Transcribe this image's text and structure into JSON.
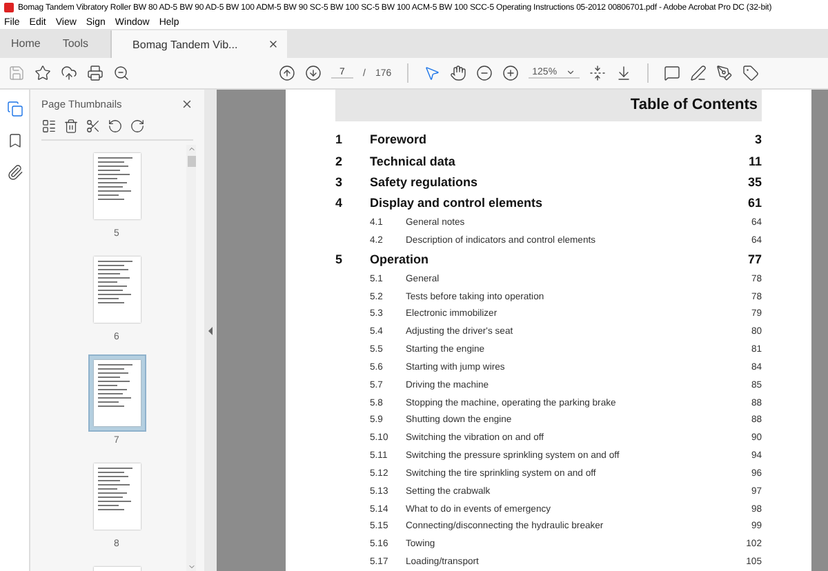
{
  "window": {
    "title": "Bomag Tandem Vibratory Roller BW 80 AD-5 BW 90 AD-5 BW 100 ADM-5 BW 90 SC-5 BW 100 SC-5 BW 100 ACM-5 BW 100 SCC-5 Operating Instructions 05-2012 00806701.pdf - Adobe Acrobat Pro DC (32-bit)"
  },
  "menu": [
    "File",
    "Edit",
    "View",
    "Sign",
    "Window",
    "Help"
  ],
  "tabs": [
    {
      "label": "Home",
      "selected": false,
      "kind": "nav"
    },
    {
      "label": "Tools",
      "selected": false,
      "kind": "nav"
    },
    {
      "label": "Bomag Tandem Vib...",
      "selected": true,
      "kind": "document"
    }
  ],
  "toolbar": {
    "page_current": "7",
    "page_separator": "/",
    "page_total": "176",
    "zoom": "125%"
  },
  "sidebar": {
    "title": "Page Thumbnails",
    "thumbnails": [
      {
        "label": "5",
        "selected": false
      },
      {
        "label": "6",
        "selected": false
      },
      {
        "label": "7",
        "selected": true
      },
      {
        "label": "8",
        "selected": false
      },
      {
        "selected": false
      }
    ]
  },
  "document": {
    "heading": "Table of Contents",
    "entries": [
      {
        "kind": "chapter",
        "number": "1",
        "title": "Foreword",
        "page": "3"
      },
      {
        "kind": "chapter",
        "number": "2",
        "title": "Technical data",
        "page": "11"
      },
      {
        "kind": "chapter",
        "number": "3",
        "title": "Safety regulations",
        "page": "35"
      },
      {
        "kind": "chapter",
        "number": "4",
        "title": "Display and control elements",
        "page": "61"
      },
      {
        "kind": "section",
        "number": "4.1",
        "title": "General notes",
        "page": "64"
      },
      {
        "kind": "section",
        "number": "4.2",
        "title": "Description of indicators and control elements",
        "page": "64"
      },
      {
        "kind": "chapter",
        "number": "5",
        "title": "Operation",
        "page": "77"
      },
      {
        "kind": "section",
        "number": "5.1",
        "title": "General",
        "page": "78"
      },
      {
        "kind": "section",
        "number": "5.2",
        "title": "Tests before taking into operation",
        "page": "78"
      },
      {
        "kind": "section",
        "number": "5.3",
        "title": "Electronic immobilizer",
        "page": "79"
      },
      {
        "kind": "section",
        "number": "5.4",
        "title": "Adjusting the driver's seat",
        "page": "80"
      },
      {
        "kind": "section",
        "number": "5.5",
        "title": "Starting the engine",
        "page": "81"
      },
      {
        "kind": "section",
        "number": "5.6",
        "title": "Starting with jump wires",
        "page": "84"
      },
      {
        "kind": "section",
        "number": "5.7",
        "title": "Driving the machine",
        "page": "85"
      },
      {
        "kind": "section",
        "number": "5.8",
        "title": "Stopping the machine, operating the parking brake",
        "page": "88"
      },
      {
        "kind": "section",
        "number": "5.9",
        "title": "Shutting down the engine",
        "page": "88"
      },
      {
        "kind": "section",
        "number": "5.10",
        "title": "Switching the vibration on and off",
        "page": "90"
      },
      {
        "kind": "section",
        "number": "5.11",
        "title": "Switching the pressure sprinkling system on and off",
        "page": "94"
      },
      {
        "kind": "section",
        "number": "5.12",
        "title": "Switching the tire sprinkling system on and off",
        "page": "96"
      },
      {
        "kind": "section",
        "number": "5.13",
        "title": "Setting the crabwalk",
        "page": "97"
      },
      {
        "kind": "section",
        "number": "5.14",
        "title": "What to do in events of emergency",
        "page": "98"
      },
      {
        "kind": "section",
        "number": "5.15",
        "title": "Connecting/disconnecting the hydraulic breaker",
        "page": "99"
      },
      {
        "kind": "section",
        "number": "5.16",
        "title": "Towing",
        "page": "102"
      },
      {
        "kind": "section",
        "number": "5.17",
        "title": "Loading/transport",
        "page": "105"
      }
    ]
  }
}
